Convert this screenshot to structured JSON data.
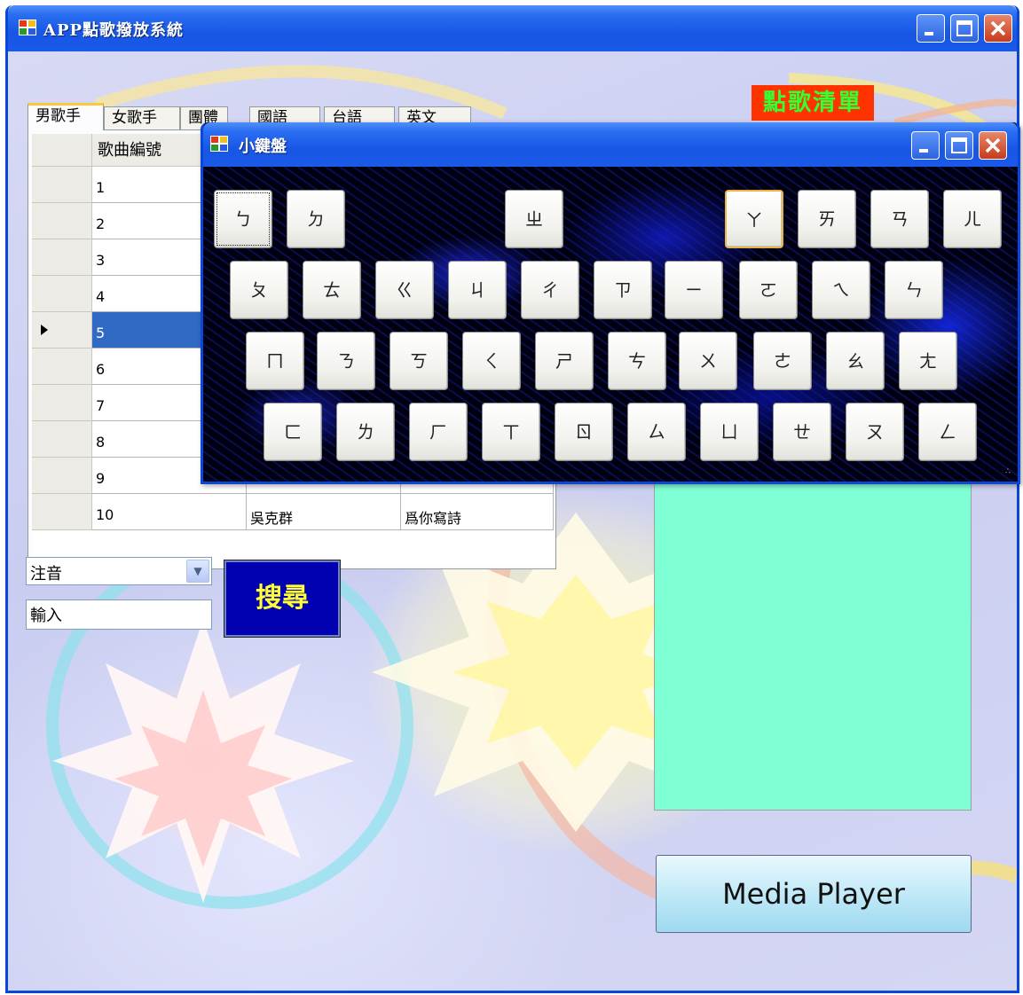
{
  "window": {
    "title": "APP點歌撥放系統"
  },
  "tabs": [
    "男歌手",
    "女歌手",
    "團體",
    "國語",
    "台語",
    "英文"
  ],
  "grid": {
    "headers": [
      "歌曲編號",
      "",
      ""
    ],
    "rows": [
      [
        "1",
        "",
        ""
      ],
      [
        "2",
        "",
        ""
      ],
      [
        "3",
        "",
        ""
      ],
      [
        "4",
        "",
        ""
      ],
      [
        "5",
        "",
        ""
      ],
      [
        "6",
        "",
        ""
      ],
      [
        "7",
        "",
        ""
      ],
      [
        "8",
        "",
        ""
      ],
      [
        "9",
        "",
        ""
      ],
      [
        "10",
        "吳克群",
        "爲你寫詩"
      ]
    ],
    "selected_row": 5
  },
  "list_title": "點歌清單",
  "search": {
    "mode_value": "注音",
    "input_value": "輸入",
    "button_label": "搜尋"
  },
  "media_button_label": "Media Player",
  "keyboard": {
    "title": "小鍵盤",
    "rows": [
      [
        "ㄅ",
        "ㄉ",
        "ㄓ",
        "ㄚ",
        "ㄞ",
        "ㄢ",
        "ㄦ"
      ],
      [
        "ㄆ",
        "ㄊ",
        "ㄍ",
        "ㄐ",
        "ㄔ",
        "ㄗ",
        "ㄧ",
        "ㄛ",
        "ㄟ",
        "ㄣ"
      ],
      [
        "ㄇ",
        "ㄋ",
        "ㄎ",
        "ㄑ",
        "ㄕ",
        "ㄘ",
        "ㄨ",
        "ㄜ",
        "ㄠ",
        "ㄤ"
      ],
      [
        "ㄈ",
        "ㄌ",
        "ㄏ",
        "ㄒ",
        "ㄖ",
        "ㄙ",
        "ㄩ",
        "ㄝ",
        "ㄡ",
        "ㄥ"
      ]
    ]
  },
  "colors": {
    "titlebar": "#1856e4",
    "list_badge_bg": "#ff3300",
    "list_badge_text": "#33ff33",
    "playlist_bg": "#7fffd4",
    "search_bg": "#0000b0",
    "search_text": "#ffff33",
    "selection": "#316ac5"
  },
  "icons": [
    "app-icon",
    "minimize-icon",
    "maximize-icon",
    "close-icon",
    "dropdown-arrow-icon",
    "row-pointer-icon"
  ]
}
